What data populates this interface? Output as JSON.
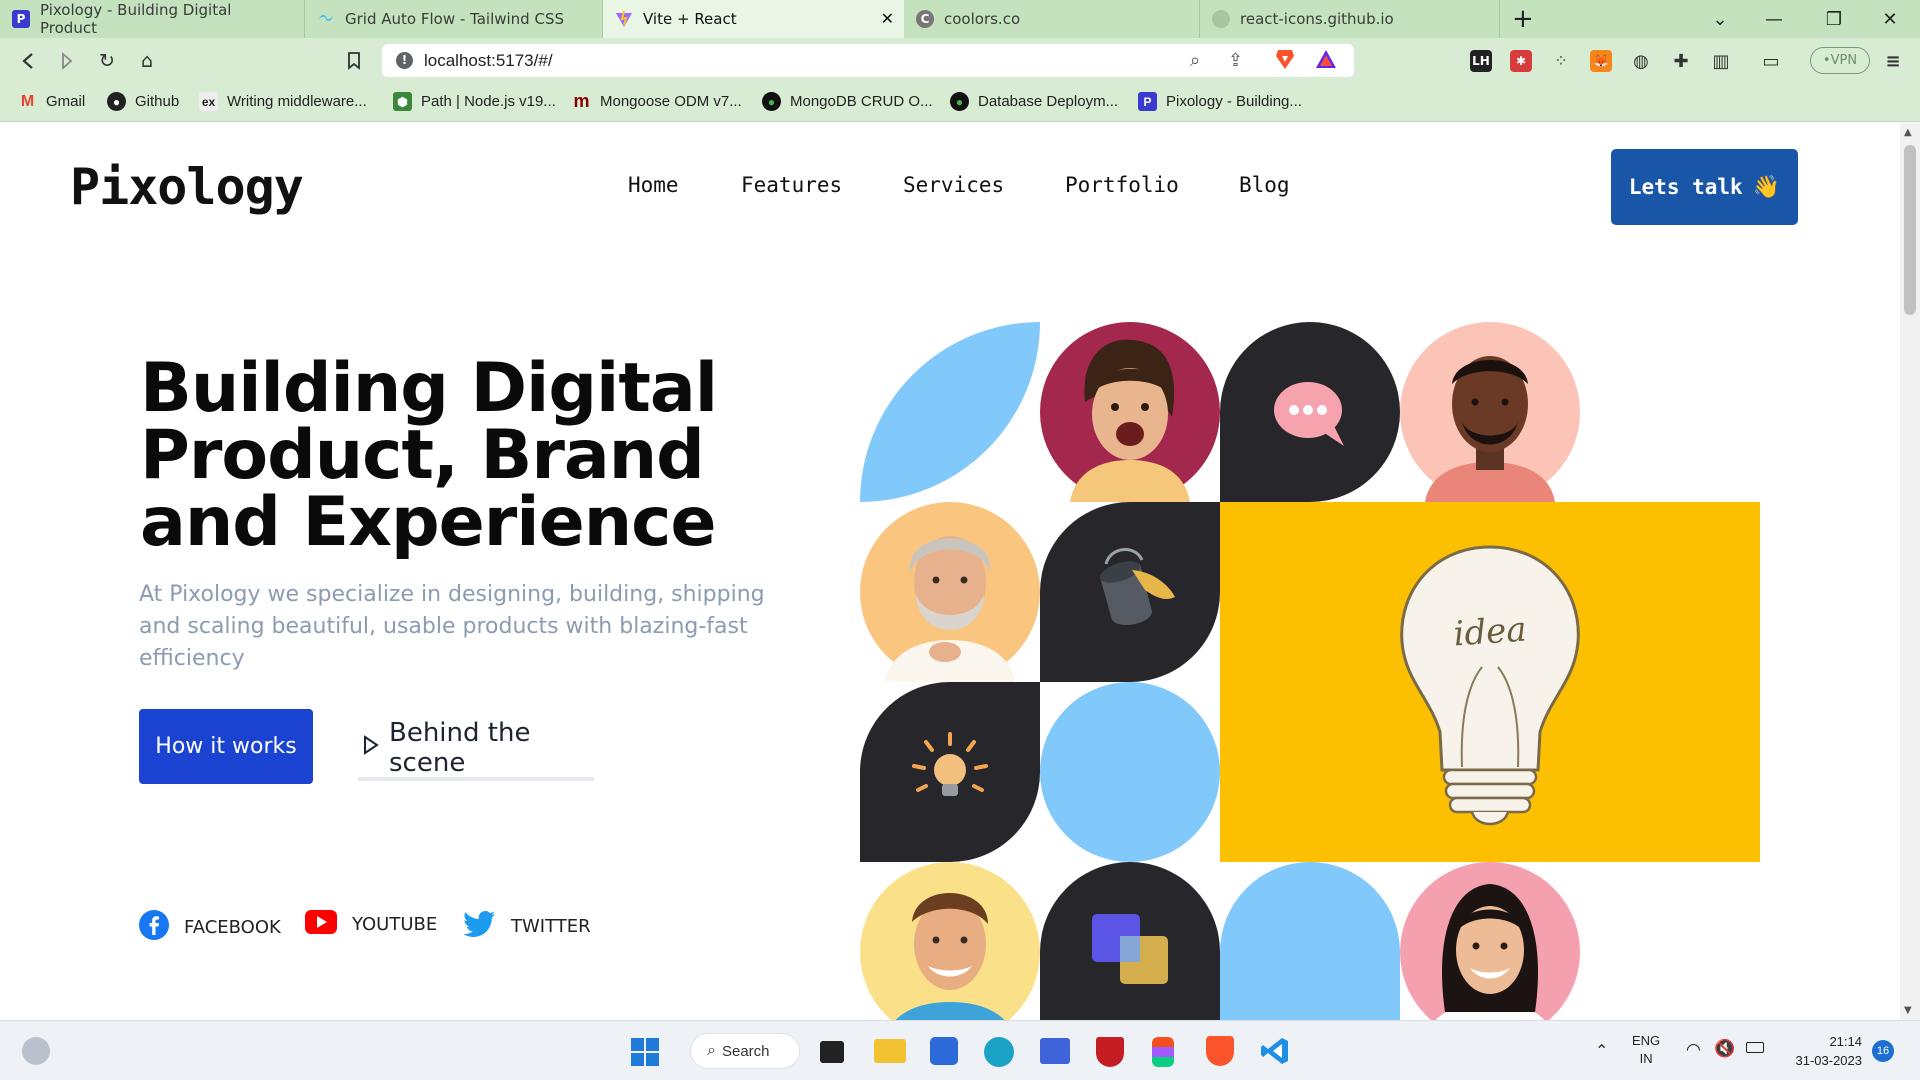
{
  "browser": {
    "tabs": [
      {
        "title": "Pixology - Building Digital Product",
        "favicon": "P"
      },
      {
        "title": "Grid Auto Flow - Tailwind CSS",
        "favicon": "tailwind"
      },
      {
        "title": "Vite + React",
        "favicon": "vite",
        "active": true
      },
      {
        "title": "coolors.co",
        "favicon": "C"
      },
      {
        "title": "react-icons.github.io",
        "favicon": "globe"
      }
    ],
    "new_tab": "+",
    "url": "localhost:5173/#/",
    "vpn_label": "VPN",
    "bookmarks": [
      {
        "label": "Gmail",
        "icon": "M",
        "color": "#ea4335"
      },
      {
        "label": "Github",
        "icon": "G",
        "color": "#222222"
      },
      {
        "label": "Writing middleware...",
        "icon": "ex",
        "color": "#444444"
      },
      {
        "label": "Path | Node.js v19...",
        "icon": "N",
        "color": "#3c873a"
      },
      {
        "label": "Mongoose ODM v7...",
        "icon": "m",
        "color": "#880000"
      },
      {
        "label": "MongoDB CRUD O...",
        "icon": "•",
        "color": "#0b5d32"
      },
      {
        "label": "Database Deploym...",
        "icon": "•",
        "color": "#0b5d32"
      },
      {
        "label": "Pixology - Building...",
        "icon": "P",
        "color": "#3a3ad1"
      }
    ]
  },
  "site": {
    "logo": "Pixology",
    "nav": [
      "Home",
      "Features",
      "Services",
      "Portfolio",
      "Blog"
    ],
    "cta": "Lets talk",
    "cta_emoji": "👋",
    "hero": {
      "title": "Building Digital Product, Brand and Experience",
      "subtitle": "At Pixology we specialize in designing, building, shipping and scaling beautiful, usable products with blazing-fast efficiency",
      "primary_button": "How it works",
      "secondary_button": "Behind the scene"
    },
    "social": [
      {
        "label": "FACEBOOK",
        "icon": "facebook-icon",
        "color": "#1877f2"
      },
      {
        "label": "YOUTUBE",
        "icon": "youtube-icon",
        "color": "#ff0000"
      },
      {
        "label": "TWITTER",
        "icon": "twitter-icon",
        "color": "#1d9bf0"
      }
    ],
    "mosaic_idea_text": "idea"
  },
  "taskbar": {
    "search": "Search",
    "lang_top": "ENG",
    "lang_bottom": "IN",
    "time": "21:14",
    "date": "31-03-2023",
    "notifications": "16"
  },
  "colors": {
    "accent_blue": "#1b43d1",
    "cta_blue": "#1a56a8",
    "sky": "#82c9fb",
    "dark": "#26262b",
    "yellow": "#fdc000"
  }
}
